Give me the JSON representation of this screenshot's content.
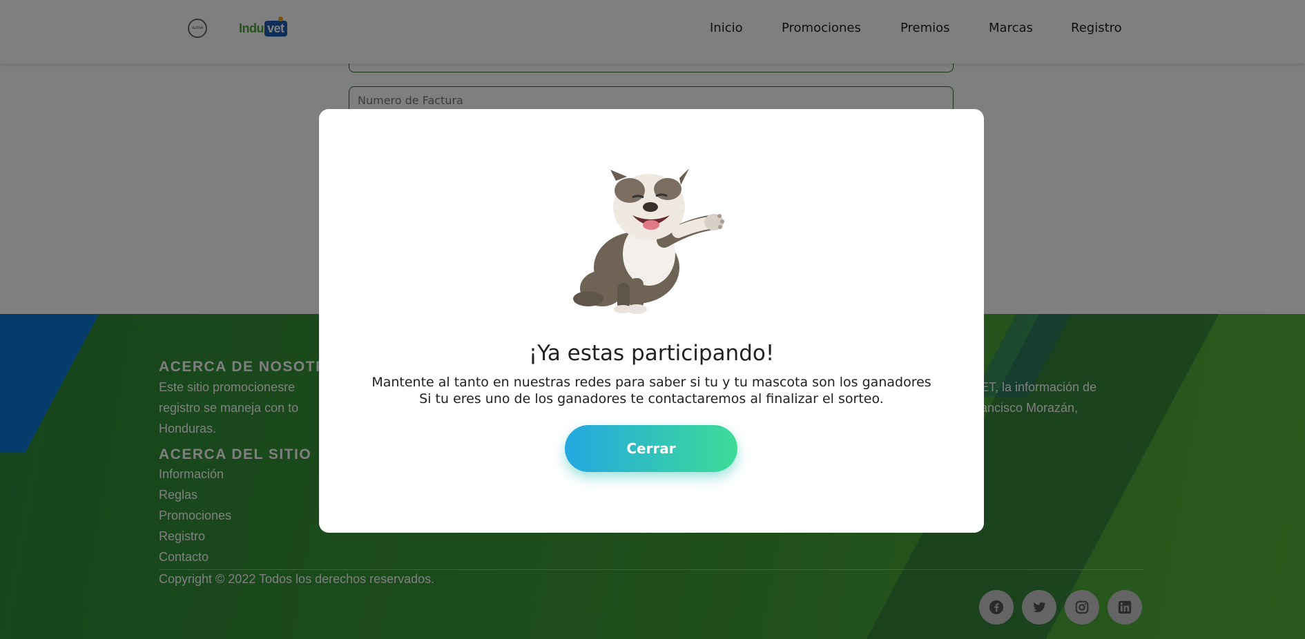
{
  "header": {
    "logo_seal_text": "ALENA",
    "logo_indu": "Indu",
    "logo_vet": "vet",
    "nav": [
      "Inicio",
      "Promociones",
      "Premios",
      "Marcas",
      "Registro"
    ]
  },
  "form": {
    "invoice_placeholder": "Numero de Factura"
  },
  "footer": {
    "about_heading": "ACERCA DE NOSOTROS",
    "about_line1": "Este sitio promocionesre",
    "about_line2": "registro se maneja con to",
    "about_line3": "Honduras.",
    "right_line1": "ET, la información de",
    "right_line2": "ancisco Morazán,",
    "site_heading": "ACERCA DEL SITIO",
    "links": [
      "Información",
      "Reglas",
      "Promociones",
      "Registro",
      "Contacto"
    ],
    "copyright": "Copyright © 2022 Todos los derechos reservados.",
    "social_icons": [
      "facebook-icon",
      "twitter-icon",
      "instagram-icon",
      "linkedin-icon"
    ]
  },
  "modal": {
    "title": "¡Ya estas participando!",
    "line1": "Mantente al tanto en nuestras redes para saber si tu y tu mascota son los ganadores",
    "line2": "Si tu eres uno de los ganadores te contactaremos al finalizar el sorteo.",
    "close_label": "Cerrar"
  }
}
